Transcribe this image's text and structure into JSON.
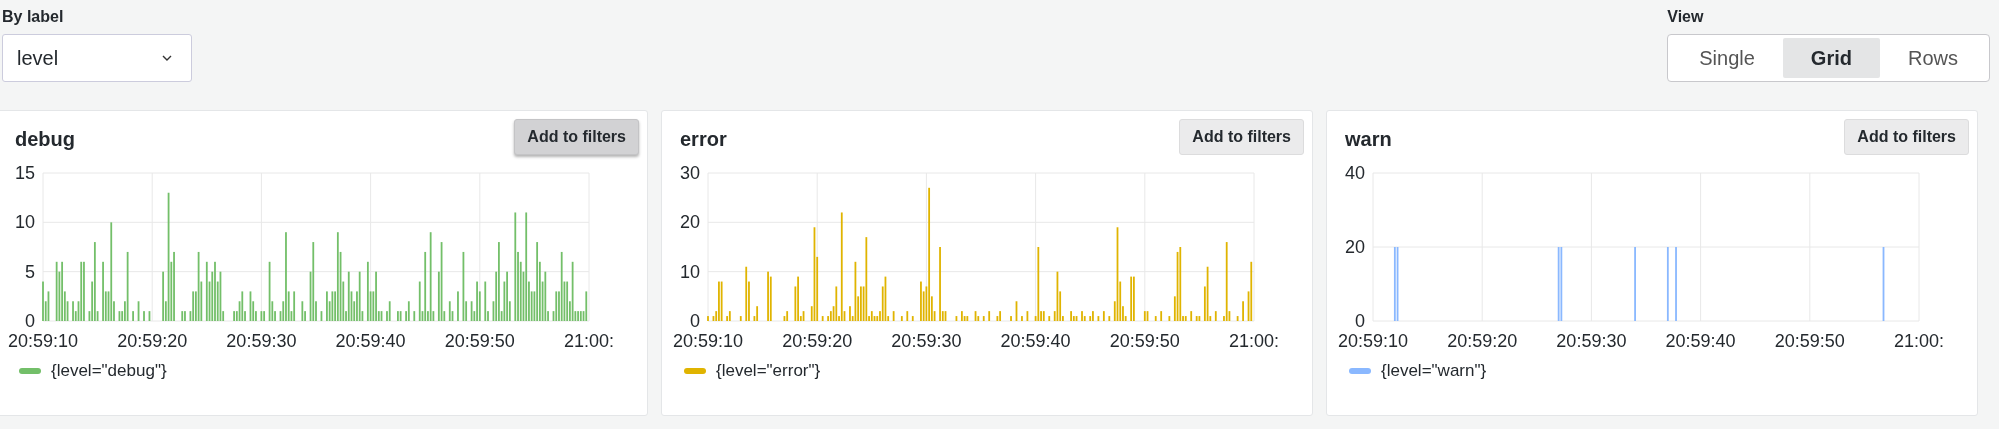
{
  "label_picker": {
    "label": "By label",
    "value": "level"
  },
  "view": {
    "label": "View",
    "options": [
      {
        "label": "Single",
        "selected": false
      },
      {
        "label": "Grid",
        "selected": true
      },
      {
        "label": "Rows",
        "selected": false
      }
    ]
  },
  "panels": [
    {
      "title": "debug",
      "button": {
        "label": "Add to filters",
        "highlighted": true
      },
      "last_tick_tail": ":",
      "chart_data": {
        "type": "bar",
        "ylim": [
          0,
          15
        ],
        "yticks": [
          0,
          5,
          10,
          15
        ],
        "categories": [
          "20:59:10",
          null,
          null,
          null,
          null,
          null,
          null,
          null,
          null,
          null,
          null,
          null,
          null,
          null,
          null,
          null,
          null,
          null,
          null,
          null,
          null,
          null,
          null,
          null,
          null,
          null,
          null,
          null,
          null,
          null,
          null,
          null,
          null,
          null,
          null,
          null,
          null,
          null,
          null,
          null,
          "20:59:20",
          null,
          null,
          null,
          null,
          null,
          null,
          null,
          null,
          null,
          null,
          null,
          null,
          null,
          null,
          null,
          null,
          null,
          null,
          null,
          null,
          null,
          null,
          null,
          null,
          null,
          null,
          null,
          null,
          null,
          null,
          null,
          null,
          null,
          null,
          null,
          null,
          null,
          null,
          null,
          "20:59:30",
          null,
          null,
          null,
          null,
          null,
          null,
          null,
          null,
          null,
          null,
          null,
          null,
          null,
          null,
          null,
          null,
          null,
          null,
          null,
          null,
          null,
          null,
          null,
          null,
          null,
          null,
          null,
          null,
          null,
          null,
          null,
          null,
          null,
          null,
          null,
          null,
          null,
          null,
          null,
          "20:59:40",
          null,
          null,
          null,
          null,
          null,
          null,
          null,
          null,
          null,
          null,
          null,
          null,
          null,
          null,
          null,
          null,
          null,
          null,
          null,
          null,
          null,
          null,
          null,
          null,
          null,
          null,
          null,
          null,
          null,
          null,
          null,
          null,
          null,
          null,
          null,
          null,
          null,
          null,
          null,
          "20:59:50",
          null,
          null,
          null,
          null,
          null,
          null,
          null,
          null,
          null,
          null,
          null,
          null,
          null,
          null,
          null,
          null,
          null,
          null,
          null,
          null,
          null,
          null,
          null,
          null,
          null,
          null,
          null,
          null,
          null,
          null,
          null,
          null,
          null,
          null,
          null,
          null,
          null,
          null,
          null,
          "21:00"
        ],
        "series": [
          {
            "name": "{level=\"debug\"}",
            "color": "#73bf69",
            "values": [
              4,
              2,
              3,
              null,
              null,
              6,
              5,
              6,
              3,
              2,
              null,
              2,
              1,
              2,
              6,
              6,
              null,
              1,
              4,
              8,
              1,
              null,
              6,
              3,
              3,
              10,
              2,
              null,
              1,
              1,
              2,
              7,
              null,
              1,
              null,
              2,
              null,
              1,
              null,
              1,
              null,
              null,
              null,
              null,
              5,
              2,
              13,
              6,
              7,
              null,
              null,
              1,
              1,
              null,
              1,
              3,
              3,
              7,
              4,
              null,
              6,
              4,
              5,
              6,
              4,
              5,
              1,
              null,
              null,
              null,
              1,
              1,
              2,
              3,
              1,
              null,
              3,
              2,
              1,
              null,
              1,
              1,
              null,
              6,
              2,
              1,
              null,
              1,
              2,
              9,
              3,
              1,
              3,
              null,
              null,
              2,
              1,
              null,
              5,
              8,
              2,
              null,
              1,
              null,
              3,
              2,
              3,
              3,
              9,
              7,
              4,
              1,
              5,
              3,
              2,
              3,
              5,
              1,
              null,
              6,
              3,
              3,
              5,
              1,
              1,
              null,
              1,
              2,
              null,
              null,
              1,
              1,
              null,
              1,
              2,
              null,
              1,
              null,
              4,
              1,
              7,
              1,
              9,
              1,
              null,
              5,
              8,
              1,
              null,
              2,
              1,
              null,
              3,
              null,
              7,
              2,
              null,
              2,
              1,
              4,
              3,
              null,
              4,
              1,
              null,
              2,
              5,
              8,
              1,
              4,
              5,
              2,
              null,
              11,
              7,
              6,
              5,
              11,
              4,
              3,
              3,
              8,
              6,
              4,
              5,
              1,
              null,
              1,
              3,
              3,
              7,
              4,
              4,
              2,
              6,
              1,
              1,
              1,
              1,
              3,
              null
            ]
          }
        ]
      }
    },
    {
      "title": "error",
      "button": {
        "label": "Add to filters",
        "highlighted": false
      },
      "last_tick_tail": ":",
      "chart_data": {
        "type": "bar",
        "ylim": [
          0,
          30
        ],
        "yticks": [
          0,
          10,
          20,
          30
        ],
        "categories": [
          "20:59:10",
          null,
          null,
          null,
          null,
          null,
          null,
          null,
          null,
          null,
          null,
          null,
          null,
          null,
          null,
          null,
          null,
          null,
          null,
          null,
          null,
          null,
          null,
          null,
          null,
          null,
          null,
          null,
          null,
          null,
          null,
          null,
          null,
          null,
          null,
          null,
          null,
          null,
          null,
          null,
          "20:59:20",
          null,
          null,
          null,
          null,
          null,
          null,
          null,
          null,
          null,
          null,
          null,
          null,
          null,
          null,
          null,
          null,
          null,
          null,
          null,
          null,
          null,
          null,
          null,
          null,
          null,
          null,
          null,
          null,
          null,
          null,
          null,
          null,
          null,
          null,
          null,
          null,
          null,
          null,
          null,
          "20:59:30",
          null,
          null,
          null,
          null,
          null,
          null,
          null,
          null,
          null,
          null,
          null,
          null,
          null,
          null,
          null,
          null,
          null,
          null,
          null,
          null,
          null,
          null,
          null,
          null,
          null,
          null,
          null,
          null,
          null,
          null,
          null,
          null,
          null,
          null,
          null,
          null,
          null,
          null,
          null,
          "20:59:40",
          null,
          null,
          null,
          null,
          null,
          null,
          null,
          null,
          null,
          null,
          null,
          null,
          null,
          null,
          null,
          null,
          null,
          null,
          null,
          null,
          null,
          null,
          null,
          null,
          null,
          null,
          null,
          null,
          null,
          null,
          null,
          null,
          null,
          null,
          null,
          null,
          null,
          null,
          null,
          "20:59:50",
          null,
          null,
          null,
          null,
          null,
          null,
          null,
          null,
          null,
          null,
          null,
          null,
          null,
          null,
          null,
          null,
          null,
          null,
          null,
          null,
          null,
          null,
          null,
          null,
          null,
          null,
          null,
          null,
          null,
          null,
          null,
          null,
          null,
          null,
          null,
          null,
          null,
          null,
          null,
          "21:00"
        ],
        "series": [
          {
            "name": "{level=\"error\"}",
            "color": "#e0b400",
            "values": [
              1,
              null,
              1,
              2,
              8,
              8,
              null,
              1,
              2,
              null,
              null,
              null,
              1,
              null,
              11,
              8,
              null,
              1,
              3,
              null,
              null,
              null,
              10,
              9,
              null,
              null,
              null,
              null,
              1,
              2,
              null,
              null,
              7,
              9,
              1,
              2,
              null,
              null,
              3,
              19,
              13,
              null,
              1,
              null,
              1,
              2,
              3,
              7,
              1,
              22,
              2,
              null,
              3,
              1,
              12,
              5,
              7,
              7,
              17,
              1,
              2,
              1,
              1,
              2,
              7,
              9,
              1,
              null,
              2,
              null,
              null,
              1,
              null,
              2,
              null,
              1,
              null,
              null,
              8,
              6,
              7,
              27,
              5,
              2,
              null,
              15,
              2,
              2,
              null,
              null,
              null,
              1,
              null,
              2,
              1,
              1,
              null,
              null,
              2,
              1,
              null,
              1,
              null,
              2,
              null,
              null,
              1,
              2,
              null,
              null,
              null,
              1,
              null,
              4,
              null,
              1,
              null,
              2,
              null,
              null,
              1,
              15,
              2,
              2,
              null,
              1,
              null,
              2,
              10,
              6,
              1,
              null,
              null,
              2,
              1,
              1,
              null,
              2,
              1,
              null,
              1,
              2,
              null,
              1,
              null,
              2,
              null,
              1,
              null,
              4,
              19,
              8,
              3,
              1,
              null,
              9,
              9,
              null,
              null,
              null,
              2,
              2,
              null,
              null,
              1,
              null,
              2,
              null,
              null,
              1,
              null,
              5,
              14,
              15,
              1,
              1,
              null,
              2,
              null,
              1,
              1,
              null,
              7,
              11,
              1,
              null,
              2,
              null,
              null,
              1,
              16,
              2,
              null,
              null,
              1,
              null,
              4,
              null,
              6,
              12,
              null
            ]
          }
        ]
      }
    },
    {
      "title": "warn",
      "button": {
        "label": "Add to filters",
        "highlighted": false
      },
      "last_tick_tail": ":",
      "chart_data": {
        "type": "bar",
        "ylim": [
          0,
          40
        ],
        "yticks": [
          0,
          20,
          40
        ],
        "categories": [
          "20:59:10",
          null,
          null,
          null,
          null,
          null,
          null,
          null,
          null,
          null,
          null,
          null,
          null,
          null,
          null,
          null,
          null,
          null,
          null,
          null,
          null,
          null,
          null,
          null,
          null,
          null,
          null,
          null,
          null,
          null,
          null,
          null,
          null,
          null,
          null,
          null,
          null,
          null,
          null,
          null,
          "20:59:20",
          null,
          null,
          null,
          null,
          null,
          null,
          null,
          null,
          null,
          null,
          null,
          null,
          null,
          null,
          null,
          null,
          null,
          null,
          null,
          null,
          null,
          null,
          null,
          null,
          null,
          null,
          null,
          null,
          null,
          null,
          null,
          null,
          null,
          null,
          null,
          null,
          null,
          null,
          null,
          "20:59:30",
          null,
          null,
          null,
          null,
          null,
          null,
          null,
          null,
          null,
          null,
          null,
          null,
          null,
          null,
          null,
          null,
          null,
          null,
          null,
          null,
          null,
          null,
          null,
          null,
          null,
          null,
          null,
          null,
          null,
          null,
          null,
          null,
          null,
          null,
          null,
          null,
          null,
          null,
          null,
          "20:59:40",
          null,
          null,
          null,
          null,
          null,
          null,
          null,
          null,
          null,
          null,
          null,
          null,
          null,
          null,
          null,
          null,
          null,
          null,
          null,
          null,
          null,
          null,
          null,
          null,
          null,
          null,
          null,
          null,
          null,
          null,
          null,
          null,
          null,
          null,
          null,
          null,
          null,
          null,
          null,
          "20:59:50",
          null,
          null,
          null,
          null,
          null,
          null,
          null,
          null,
          null,
          null,
          null,
          null,
          null,
          null,
          null,
          null,
          null,
          null,
          null,
          null,
          null,
          null,
          null,
          null,
          null,
          null,
          null,
          null,
          null,
          null,
          null,
          null,
          null,
          null,
          null,
          null,
          null,
          null,
          null,
          "21:00"
        ],
        "series": [
          {
            "name": "{level=\"warn\"}",
            "color": "#8ab8ff",
            "values": [
              null,
              null,
              null,
              null,
              null,
              null,
              null,
              null,
              20,
              20,
              null,
              null,
              null,
              null,
              null,
              null,
              null,
              null,
              null,
              null,
              null,
              null,
              null,
              null,
              null,
              null,
              null,
              null,
              null,
              null,
              null,
              null,
              null,
              null,
              null,
              null,
              null,
              null,
              null,
              null,
              null,
              null,
              null,
              null,
              null,
              null,
              null,
              null,
              null,
              null,
              null,
              null,
              null,
              null,
              null,
              null,
              null,
              null,
              null,
              null,
              null,
              null,
              null,
              null,
              null,
              null,
              null,
              null,
              20,
              20,
              null,
              null,
              null,
              null,
              null,
              null,
              null,
              null,
              null,
              null,
              null,
              null,
              null,
              null,
              null,
              null,
              null,
              null,
              null,
              null,
              null,
              null,
              null,
              null,
              null,
              null,
              20,
              null,
              null,
              null,
              null,
              null,
              null,
              null,
              null,
              null,
              null,
              null,
              20,
              null,
              null,
              20,
              null,
              null,
              null,
              null,
              null,
              null,
              null,
              null,
              null,
              null,
              null,
              null,
              null,
              null,
              null,
              null,
              null,
              null,
              null,
              null,
              null,
              null,
              null,
              null,
              null,
              null,
              null,
              null,
              null,
              null,
              null,
              null,
              null,
              null,
              null,
              null,
              null,
              null,
              null,
              null,
              null,
              null,
              null,
              null,
              null,
              null,
              null,
              null,
              null,
              null,
              null,
              null,
              null,
              null,
              null,
              null,
              null,
              null,
              null,
              null,
              null,
              null,
              null,
              null,
              null,
              null,
              null,
              null,
              null,
              null,
              null,
              null,
              null,
              null,
              null,
              20,
              null,
              null,
              null,
              null,
              null,
              null,
              null,
              null,
              null,
              null,
              null,
              null,
              null
            ]
          }
        ]
      }
    }
  ]
}
